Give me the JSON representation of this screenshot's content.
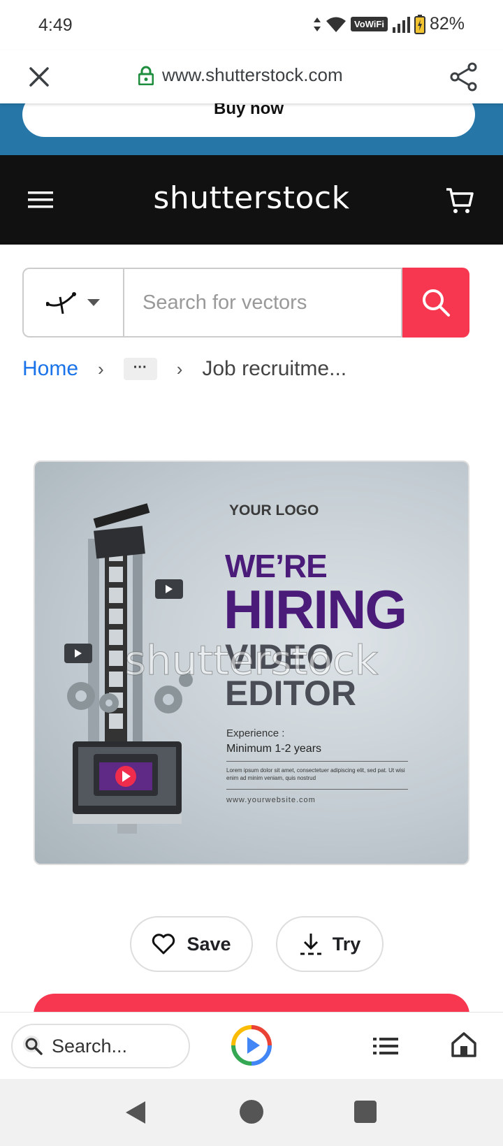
{
  "status_bar": {
    "time": "4:49",
    "network": "VoWiFi",
    "battery": "82%"
  },
  "url_bar": {
    "url": "www.shutterstock.com"
  },
  "banner": {
    "cta": "Buy now"
  },
  "header": {
    "logo": "shutterstock"
  },
  "search": {
    "placeholder": "Search for vectors",
    "type_icon": "vector-pen-icon"
  },
  "breadcrumb": {
    "home": "Home",
    "ellipsis": "···",
    "current": "Job recruitme..."
  },
  "preview": {
    "your_logo": "YOUR LOGO",
    "line1": "WE’RE",
    "line2": "HIRING",
    "line3": "VIDEO",
    "line4": "EDITOR",
    "experience_label": "Experience :",
    "experience_value": "Minimum 1-2 years",
    "lorem": "Lorem ipsum dolor sit amet, consectetuer adipiscing elit, sed pat. Ut wisi enim ad minim veniam, quis nostrud",
    "website": "www.yourwebsite.com",
    "watermark": "shutterstock"
  },
  "actions": {
    "save": "Save",
    "try": "Try"
  },
  "toolbar": {
    "search_placeholder": "Search..."
  },
  "colors": {
    "accent_red": "#f7374f",
    "banner_blue": "#2677a8",
    "header_black": "#111111",
    "link_blue": "#1a73e8",
    "hiring_purple": "#4b1b7a"
  }
}
